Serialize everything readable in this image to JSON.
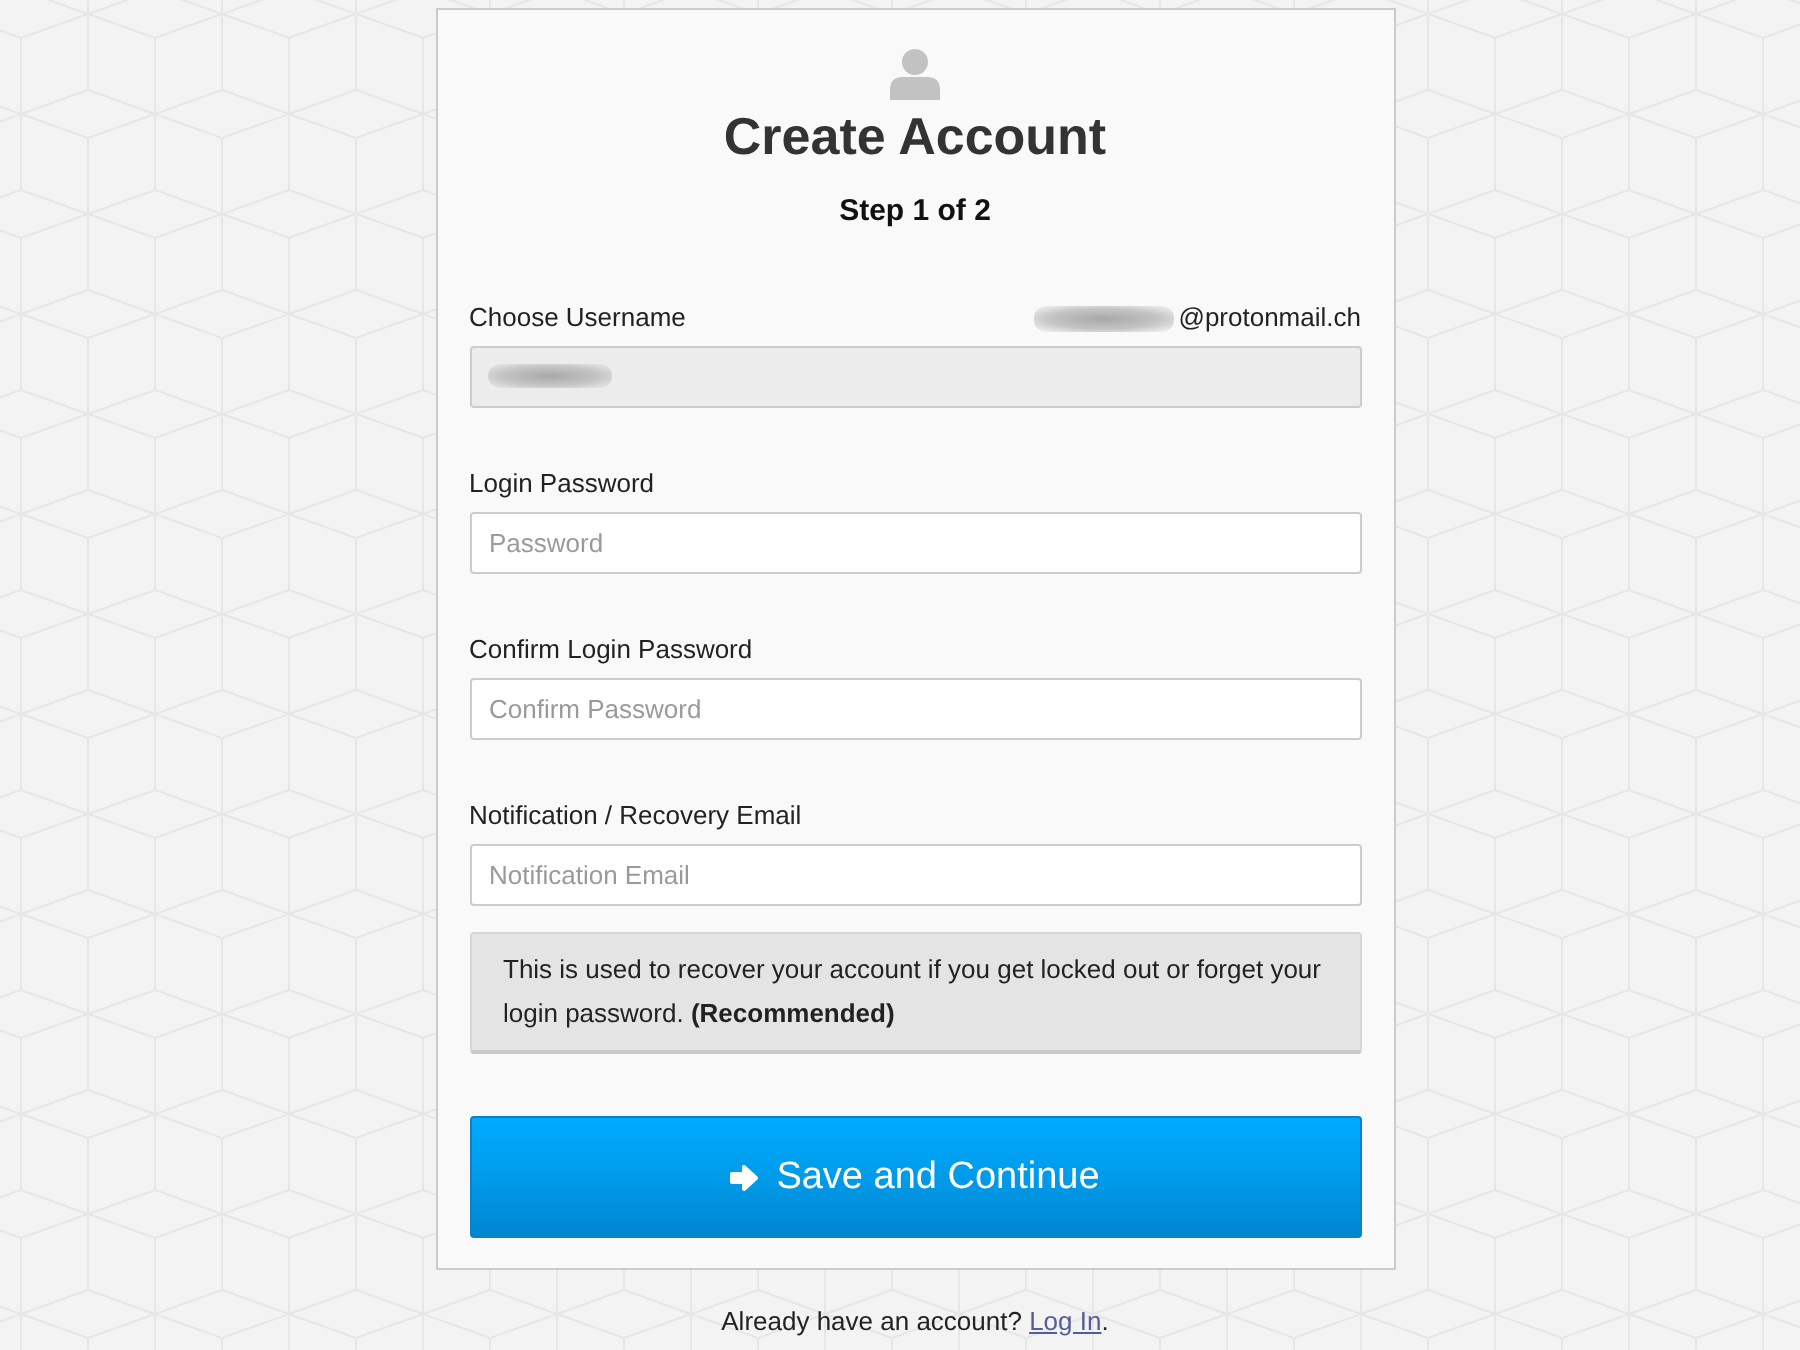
{
  "header": {
    "title": "Create Account",
    "step": "Step 1 of 2"
  },
  "fields": [
    {
      "label": "Choose Username",
      "suffix": "@protonmail.ch",
      "redacted": true,
      "disabled": true
    },
    {
      "label": "Login Password",
      "placeholder": "Password",
      "disabled": false
    },
    {
      "label": "Confirm Login Password",
      "placeholder": "Confirm Password",
      "disabled": false
    },
    {
      "label": "Notification / Recovery Email",
      "placeholder": "Notification Email",
      "disabled": false
    }
  ],
  "notice": "This is used to recover your account if you get locked out or forget your login password. **(Recommended)**",
  "submit_button": {
    "label": "Save and Continue"
  },
  "footer": {
    "text": "Already have an account?",
    "link": "Log In",
    "end": "."
  }
}
